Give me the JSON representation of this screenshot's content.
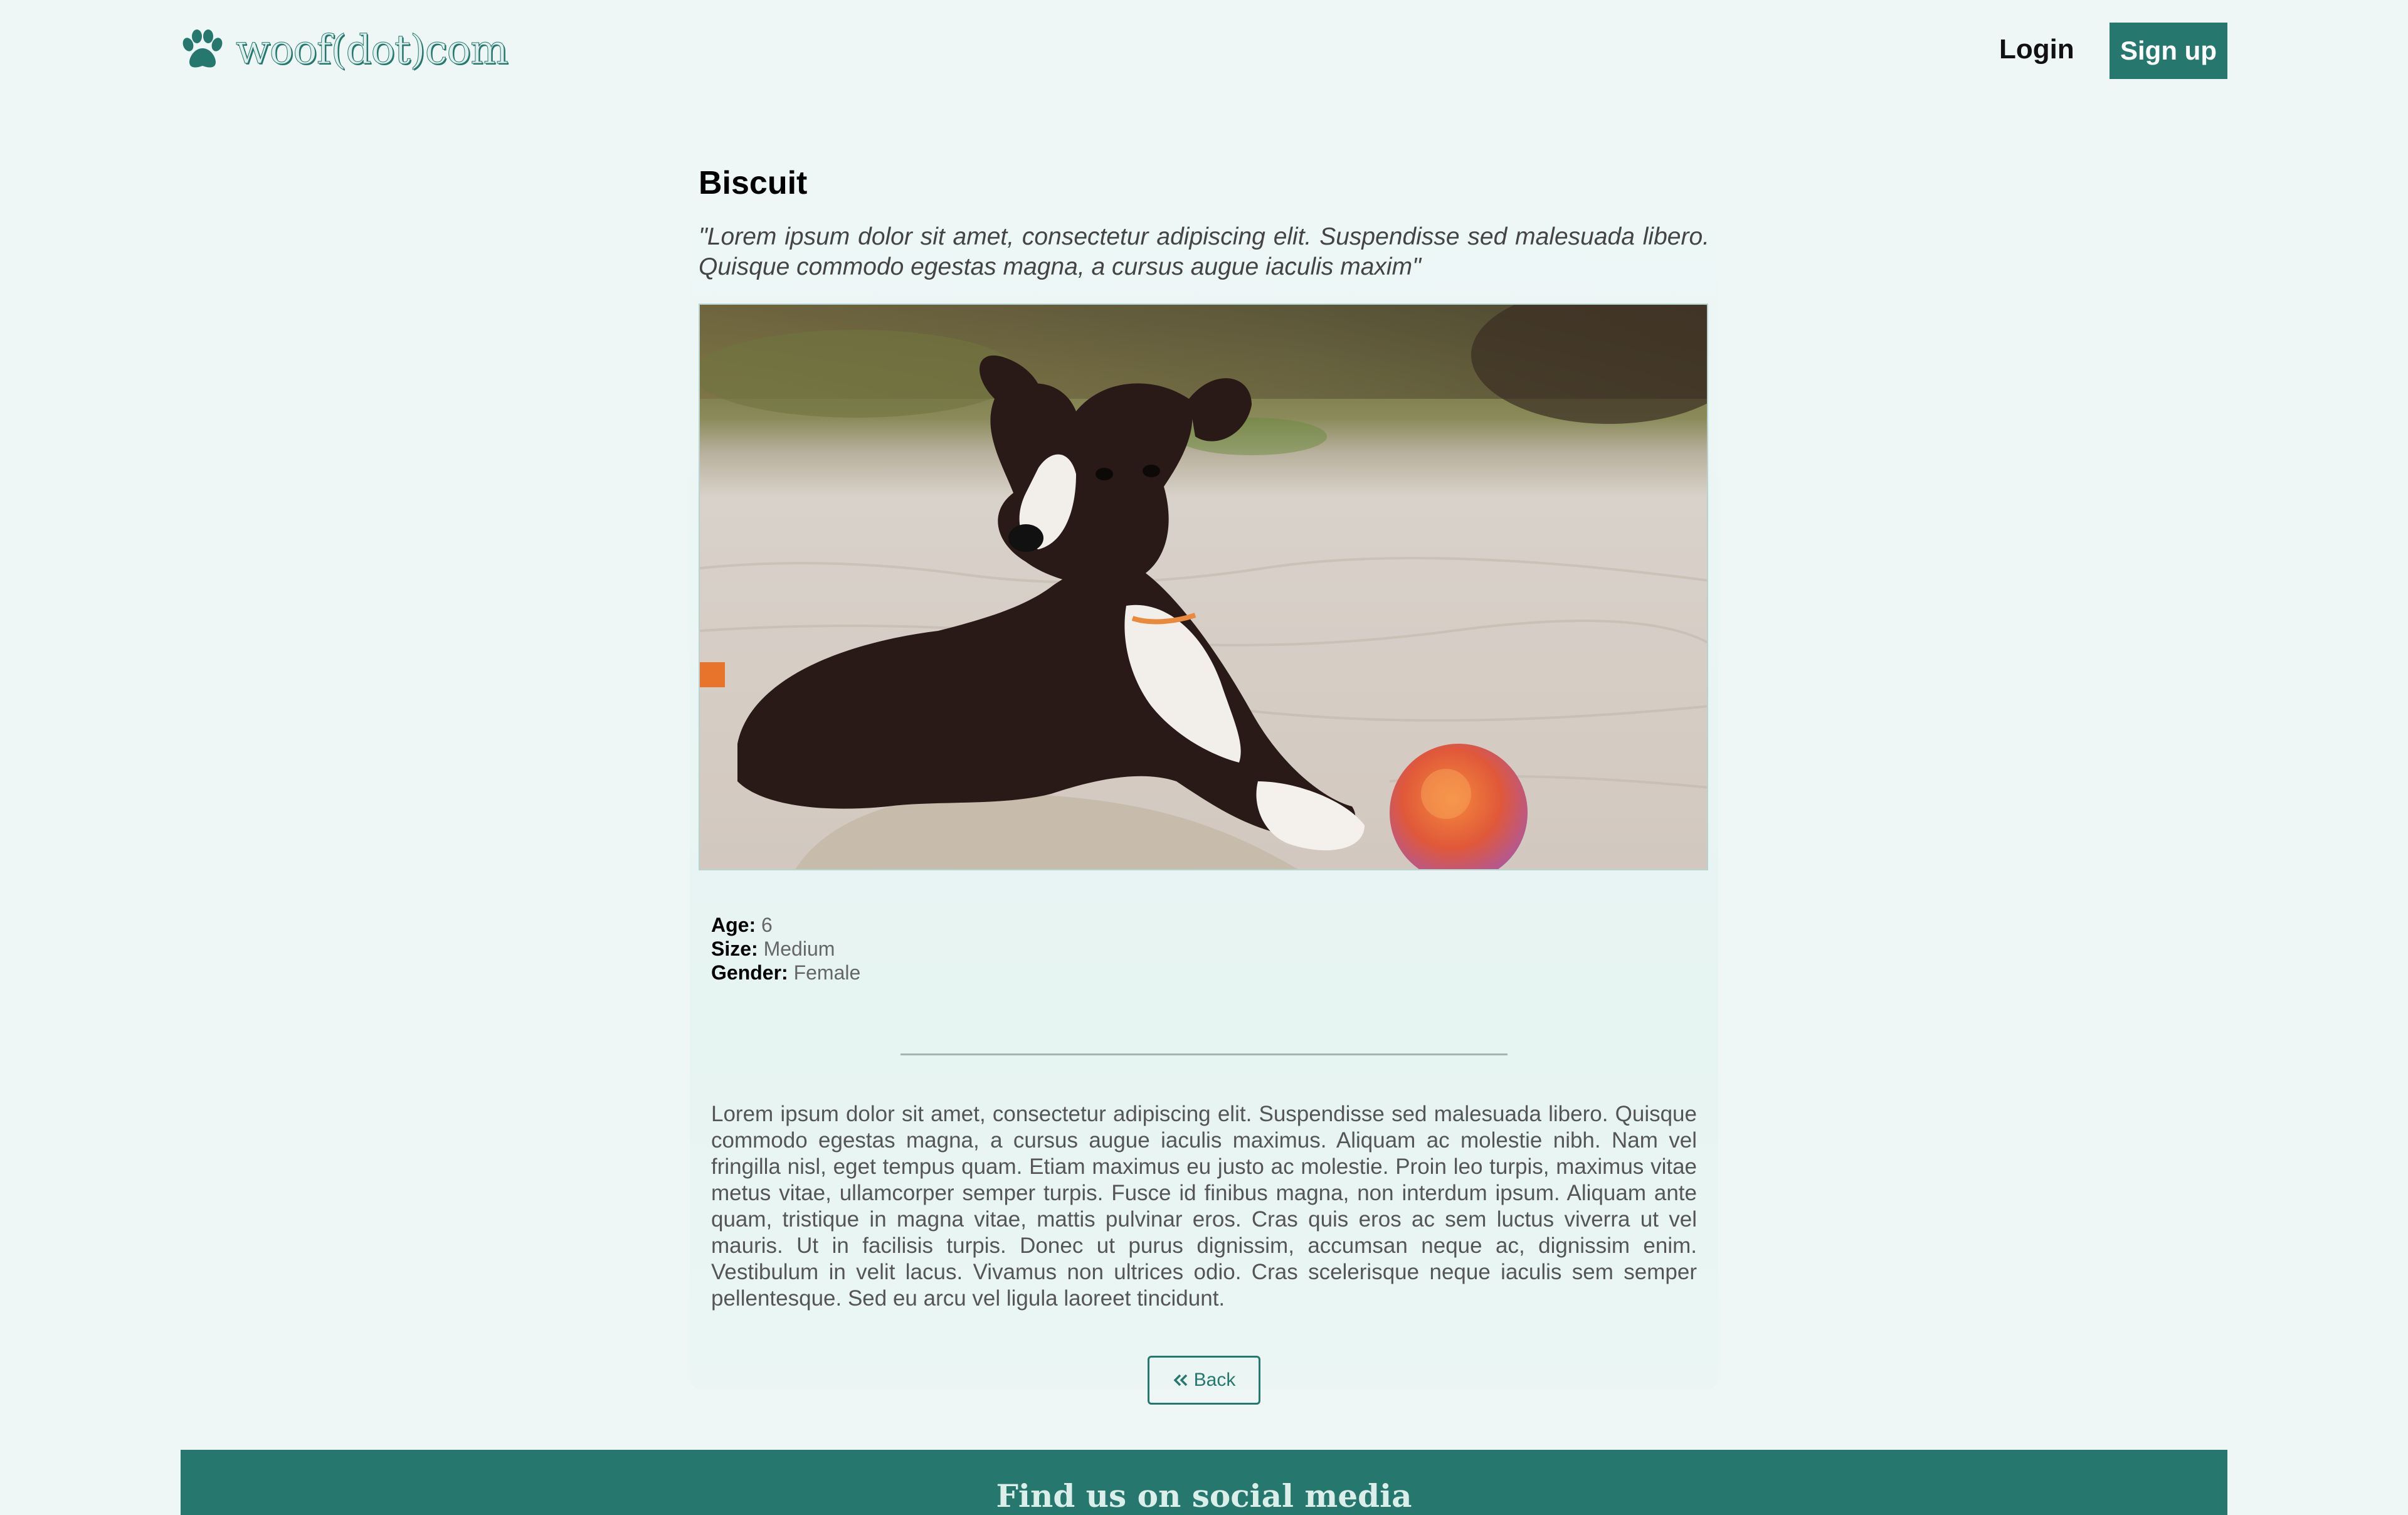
{
  "nav": {
    "brand": "woof(dot)com",
    "login_label": "Login",
    "signup_label": "Sign up"
  },
  "dog": {
    "name": "Biscuit",
    "quote": "\"Lorem ipsum dolor sit amet, consectetur adipiscing elit. Suspendisse sed malesuada libero. Quisque commodo egestas magna, a cursus augue iaculis maxim\"",
    "details": {
      "age_label": "Age:",
      "age": "6",
      "size_label": "Size:",
      "size": "Medium",
      "gender_label": "Gender:",
      "gender": "Female"
    },
    "description": "Lorem ipsum dolor sit amet, consectetur adipiscing elit. Suspendisse sed malesuada libero. Quisque commodo egestas magna, a cursus augue iaculis maximus. Aliquam ac molestie nibh. Nam vel fringilla nisl, eget tempus quam. Etiam maximus eu justo ac molestie. Proin leo turpis, maximus vitae metus vitae, ullamcorper semper turpis. Fusce id finibus magna, non interdum ipsum. Aliquam ante quam, tristique in magna vitae, mattis pulvinar eros. Cras quis eros ac sem luctus viverra ut vel mauris. Ut in facilisis turpis. Donec ut purus dignissim, accumsan neque ac, dignissim enim. Vestibulum in velit lacus. Vivamus non ultrices odio. Cras scelerisque neque iaculis sem semper pellentesque. Sed eu arcu vel ligula laoreet tincidunt."
  },
  "back_label": "Back",
  "footer": {
    "title": "Find us on social media"
  },
  "colors": {
    "accent": "#26786f",
    "background": "#eef7f6"
  },
  "icons": {
    "brand": "paw-icon",
    "back": "double-chevron-left-icon"
  }
}
